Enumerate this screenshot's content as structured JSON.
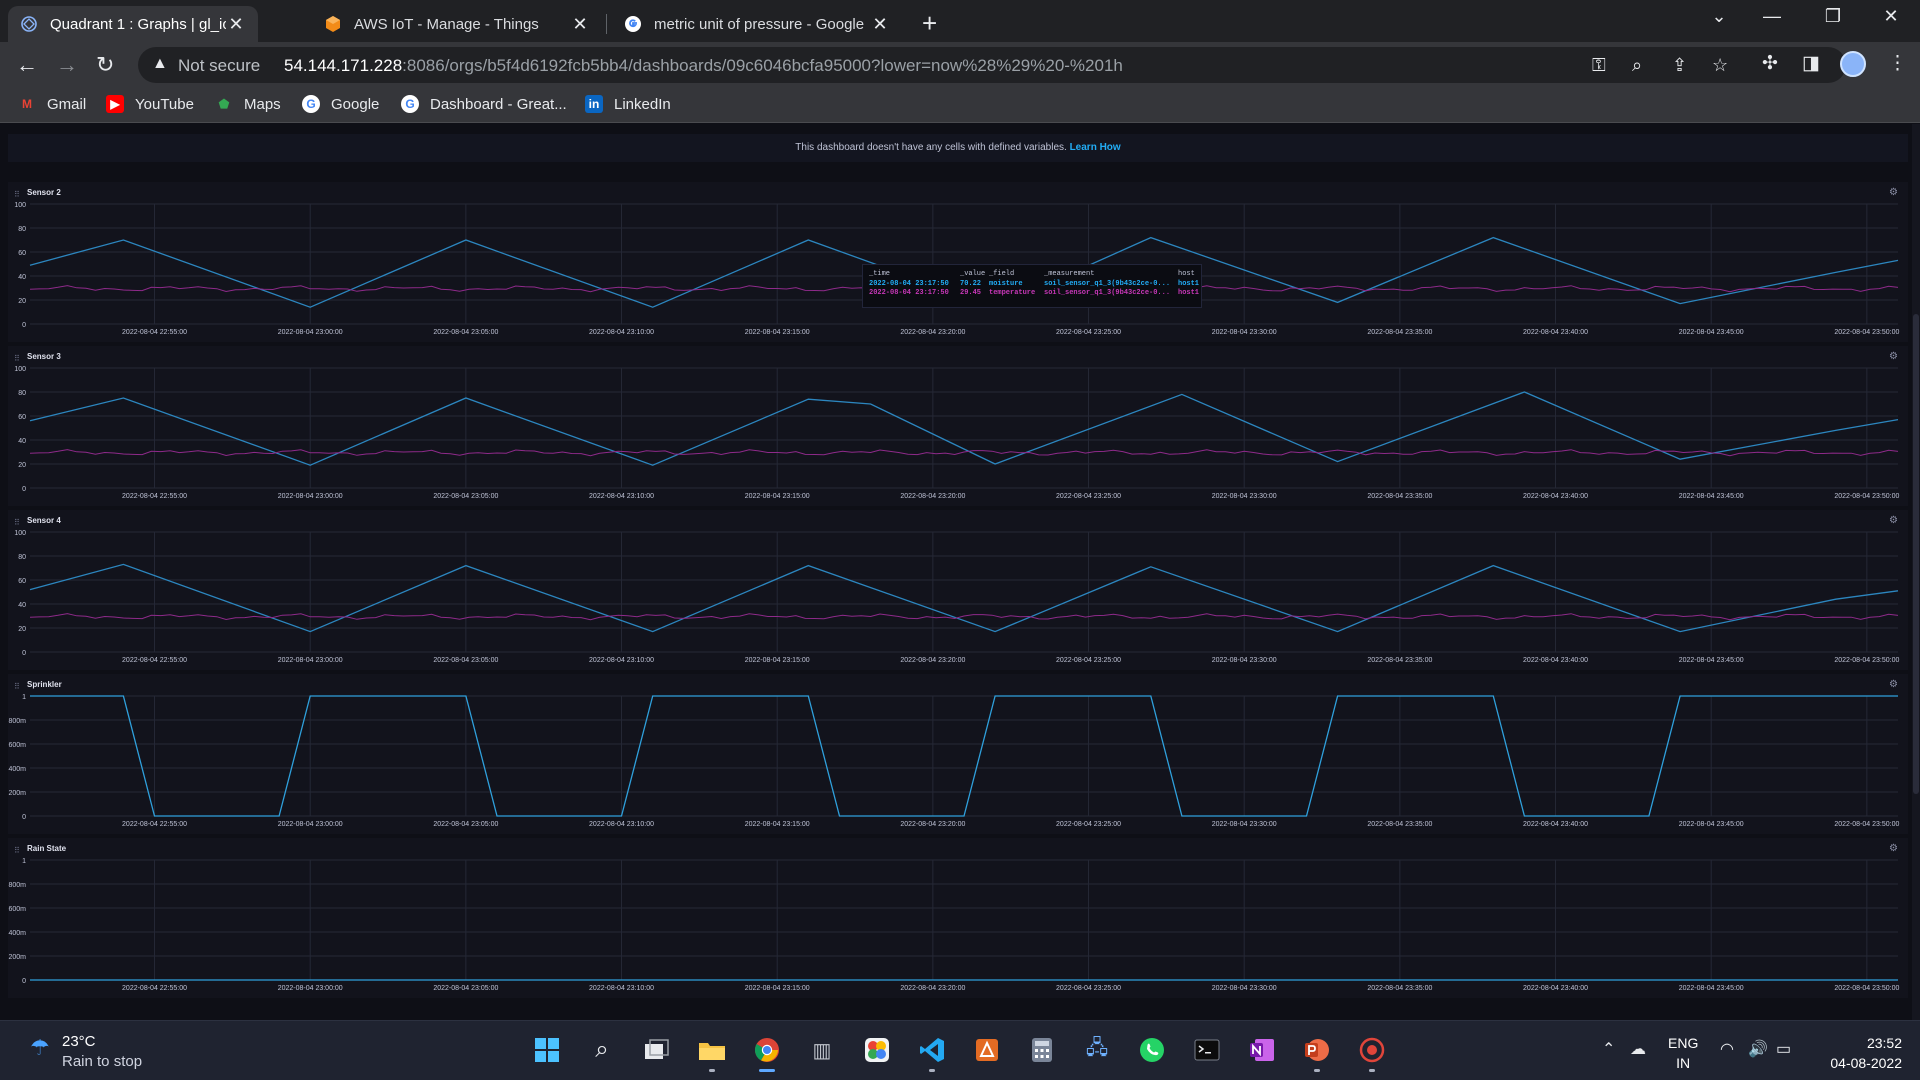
{
  "browser": {
    "tabs": [
      {
        "title": "Quadrant 1 : Graphs | gl_iot_grou",
        "favicon": "quadrant-icon",
        "active": true
      },
      {
        "title": "AWS IoT - Manage - Things",
        "favicon": "aws-icon",
        "active": false
      },
      {
        "title": "metric unit of pressure - Google",
        "favicon": "google-icon",
        "active": false
      }
    ],
    "security_label": "Not secure",
    "url_host": "54.144.171.228",
    "url_rest": ":8086/orgs/b5f4d6192fcb5bb4/dashboards/09c6046bcfa95000?lower=now%28%29%20-%201h",
    "bookmarks": [
      {
        "label": "Gmail",
        "icon": "gmail-icon",
        "color": "#ea4335"
      },
      {
        "label": "YouTube",
        "icon": "youtube-icon",
        "color": "#ff0000"
      },
      {
        "label": "Maps",
        "icon": "maps-icon",
        "color": "#34a853"
      },
      {
        "label": "Google",
        "icon": "google-icon",
        "color": "#4285f4"
      },
      {
        "label": "Dashboard - Great...",
        "icon": "google-icon",
        "color": "#4285f4"
      },
      {
        "label": "LinkedIn",
        "icon": "linkedin-icon",
        "color": "#0a66c2"
      }
    ]
  },
  "dashboard": {
    "notice_text": "This dashboard doesn't have any cells with defined variables.",
    "notice_link": "Learn How",
    "x_ticks": [
      "2022-08-04 22:55:00",
      "2022-08-04 23:00:00",
      "2022-08-04 23:05:00",
      "2022-08-04 23:10:00",
      "2022-08-04 23:15:00",
      "2022-08-04 23:20:00",
      "2022-08-04 23:25:00",
      "2022-08-04 23:30:00",
      "2022-08-04 23:35:00",
      "2022-08-04 23:40:00",
      "2022-08-04 23:45:00",
      "2022-08-04 23:50:00"
    ],
    "colors": {
      "moisture": "#2c86bf",
      "temperature": "#8e2a8a",
      "sprinkler": "#2fa0dc"
    },
    "tooltip": {
      "headers": [
        "_time",
        "_value",
        "_field",
        "_measurement",
        "host"
      ],
      "rows": [
        [
          "2022-08-04 23:17:50",
          "70.22",
          "moisture",
          "soil_sensor_q1_3(9b43c2ce-0...",
          "host1"
        ],
        [
          "2022-08-04 23:17:50",
          "29.45",
          "temperature",
          "soil_sensor_q1_3(9b43c2ce-0...",
          "host1"
        ]
      ]
    }
  },
  "chart_data": [
    {
      "type": "line",
      "title": "Sensor 2",
      "y_ticks": [
        "100",
        "80",
        "60",
        "40",
        "20",
        "0"
      ],
      "ylim": [
        0,
        100
      ],
      "x": [
        "22:51",
        "22:54",
        "23:00",
        "23:05",
        "23:11",
        "23:16",
        "23:22",
        "23:27",
        "23:33",
        "23:38",
        "23:44",
        "23:49",
        "23:51"
      ],
      "series": [
        {
          "field": "moisture",
          "values": [
            49,
            70,
            14,
            70,
            14,
            70,
            14,
            72,
            18,
            72,
            17,
            43,
            53
          ]
        },
        {
          "field": "temperature",
          "values": [
            30,
            28,
            31,
            29,
            30,
            28,
            31,
            29,
            30,
            28,
            31,
            29,
            30
          ]
        }
      ]
    },
    {
      "type": "line",
      "title": "Sensor 3",
      "y_ticks": [
        "100",
        "80",
        "60",
        "40",
        "20",
        "0"
      ],
      "ylim": [
        0,
        100
      ],
      "x": [
        "22:51",
        "22:54",
        "23:00",
        "23:05",
        "23:11",
        "23:16",
        "23:18",
        "23:22",
        "23:28",
        "23:33",
        "23:39",
        "23:44",
        "23:49",
        "23:51"
      ],
      "series": [
        {
          "field": "moisture",
          "values": [
            56,
            75,
            19,
            75,
            19,
            74,
            70,
            20,
            78,
            22,
            80,
            24,
            48,
            57
          ]
        },
        {
          "field": "temperature",
          "values": [
            30,
            28,
            31,
            29,
            30,
            28,
            29,
            31,
            29,
            30,
            28,
            31,
            29,
            30
          ]
        }
      ]
    },
    {
      "type": "line",
      "title": "Sensor 4",
      "y_ticks": [
        "100",
        "80",
        "60",
        "40",
        "20",
        "0"
      ],
      "ylim": [
        0,
        100
      ],
      "x": [
        "22:51",
        "22:54",
        "23:00",
        "23:05",
        "23:11",
        "23:16",
        "23:22",
        "23:27",
        "23:33",
        "23:38",
        "23:44",
        "23:49",
        "23:51"
      ],
      "series": [
        {
          "field": "moisture",
          "values": [
            52,
            73,
            17,
            72,
            17,
            72,
            17,
            71,
            17,
            72,
            17,
            44,
            51
          ]
        },
        {
          "field": "temperature",
          "values": [
            30,
            28,
            31,
            29,
            30,
            28,
            31,
            29,
            30,
            28,
            31,
            29,
            30
          ]
        }
      ]
    },
    {
      "type": "line",
      "title": "Sprinkler",
      "step": true,
      "y_ticks": [
        "1",
        "800m",
        "600m",
        "400m",
        "200m",
        "0"
      ],
      "ylim": [
        0,
        1
      ],
      "x": [
        "22:51",
        "22:54",
        "22:55",
        "22:59",
        "23:00",
        "23:05",
        "23:06",
        "23:10",
        "23:11",
        "23:16",
        "23:17",
        "23:21",
        "23:22",
        "23:27",
        "23:28",
        "23:32",
        "23:33",
        "23:38",
        "23:39",
        "23:43",
        "23:44",
        "23:51"
      ],
      "series": [
        {
          "field": "sprinkler",
          "values": [
            1,
            1,
            0,
            0,
            1,
            1,
            0,
            0,
            1,
            1,
            0,
            0,
            1,
            1,
            0,
            0,
            1,
            1,
            0,
            0,
            1,
            1
          ]
        }
      ]
    },
    {
      "type": "line",
      "title": "Rain State",
      "y_ticks": [
        "1",
        "800m",
        "600m",
        "400m",
        "200m",
        "0"
      ],
      "ylim": [
        0,
        1
      ],
      "x": [
        "22:51",
        "23:51"
      ],
      "series": [
        {
          "field": "rain",
          "values": [
            0,
            0
          ]
        }
      ]
    }
  ],
  "taskbar": {
    "weather_temp": "23°C",
    "weather_desc": "Rain to stop",
    "apps": [
      "start-icon",
      "search-icon",
      "task-view-icon",
      "file-explorer-icon",
      "chrome-icon",
      "app-icon",
      "photos-icon",
      "vscode-icon",
      "app-icon",
      "calculator-icon",
      "network-icon",
      "whatsapp-icon",
      "terminal-icon",
      "onenote-icon",
      "powerpoint-icon",
      "recorder-icon"
    ],
    "lang_line1": "ENG",
    "lang_line2": "IN",
    "time": "23:52",
    "date": "04-08-2022"
  }
}
